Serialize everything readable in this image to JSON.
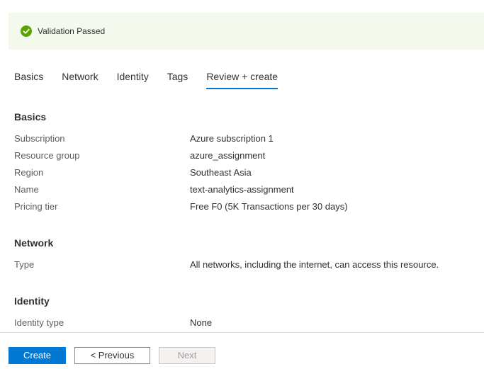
{
  "banner": {
    "message": "Validation Passed",
    "icon": "check-circle-icon",
    "color": "#57a300"
  },
  "tabs": [
    {
      "label": "Basics",
      "active": false
    },
    {
      "label": "Network",
      "active": false
    },
    {
      "label": "Identity",
      "active": false
    },
    {
      "label": "Tags",
      "active": false
    },
    {
      "label": "Review + create",
      "active": true
    }
  ],
  "sections": {
    "basics": {
      "title": "Basics",
      "rows": [
        {
          "label": "Subscription",
          "value": "Azure subscription 1"
        },
        {
          "label": "Resource group",
          "value": "azure_assignment"
        },
        {
          "label": "Region",
          "value": "Southeast Asia"
        },
        {
          "label": "Name",
          "value": "text-analytics-assignment"
        },
        {
          "label": "Pricing tier",
          "value": "Free F0 (5K Transactions per 30 days)"
        }
      ]
    },
    "network": {
      "title": "Network",
      "rows": [
        {
          "label": "Type",
          "value": "All networks, including the internet, can access this resource."
        }
      ]
    },
    "identity": {
      "title": "Identity",
      "rows": [
        {
          "label": "Identity type",
          "value": "None"
        }
      ]
    }
  },
  "footer": {
    "create_label": "Create",
    "previous_label": "< Previous",
    "next_label": "Next"
  },
  "colors": {
    "accent": "#0078d4",
    "banner_bg": "#f3f9ed"
  }
}
